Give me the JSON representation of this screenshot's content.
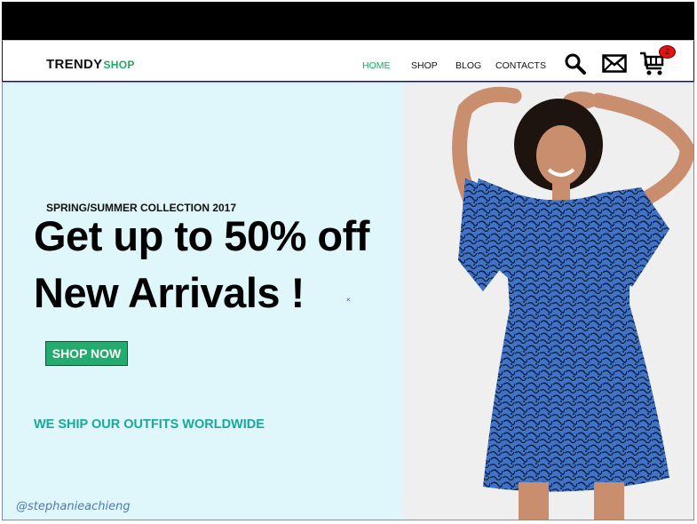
{
  "header": {
    "logo_main": "TRENDY",
    "logo_accent": "SHOP",
    "nav": [
      {
        "label": "HOME",
        "active": true
      },
      {
        "label": "SHOP",
        "active": false
      },
      {
        "label": "BLOG",
        "active": false
      },
      {
        "label": "CONTACTS",
        "active": false
      }
    ],
    "icons": [
      "search-icon",
      "mail-icon",
      "cart-icon"
    ],
    "cart_count": "2"
  },
  "hero": {
    "collection": "SPRING/SUMMER COLLECTION 2017",
    "headline_line1": "Get up to 50% off",
    "headline_line2": "New Arrivals !",
    "close_mark": "×",
    "cta_label": "SHOP NOW",
    "shipping_note": "WE SHIP OUR OUTFITS WORLDWIDE",
    "image": "model-in-blue-printed-dress"
  },
  "watermark": "@stephanieachieng",
  "colors": {
    "accent": "#20a86a",
    "hero_bg": "#dff6fb",
    "ship_text": "#17a99a",
    "badge": "#e81010",
    "dress": "#3f73c8"
  }
}
